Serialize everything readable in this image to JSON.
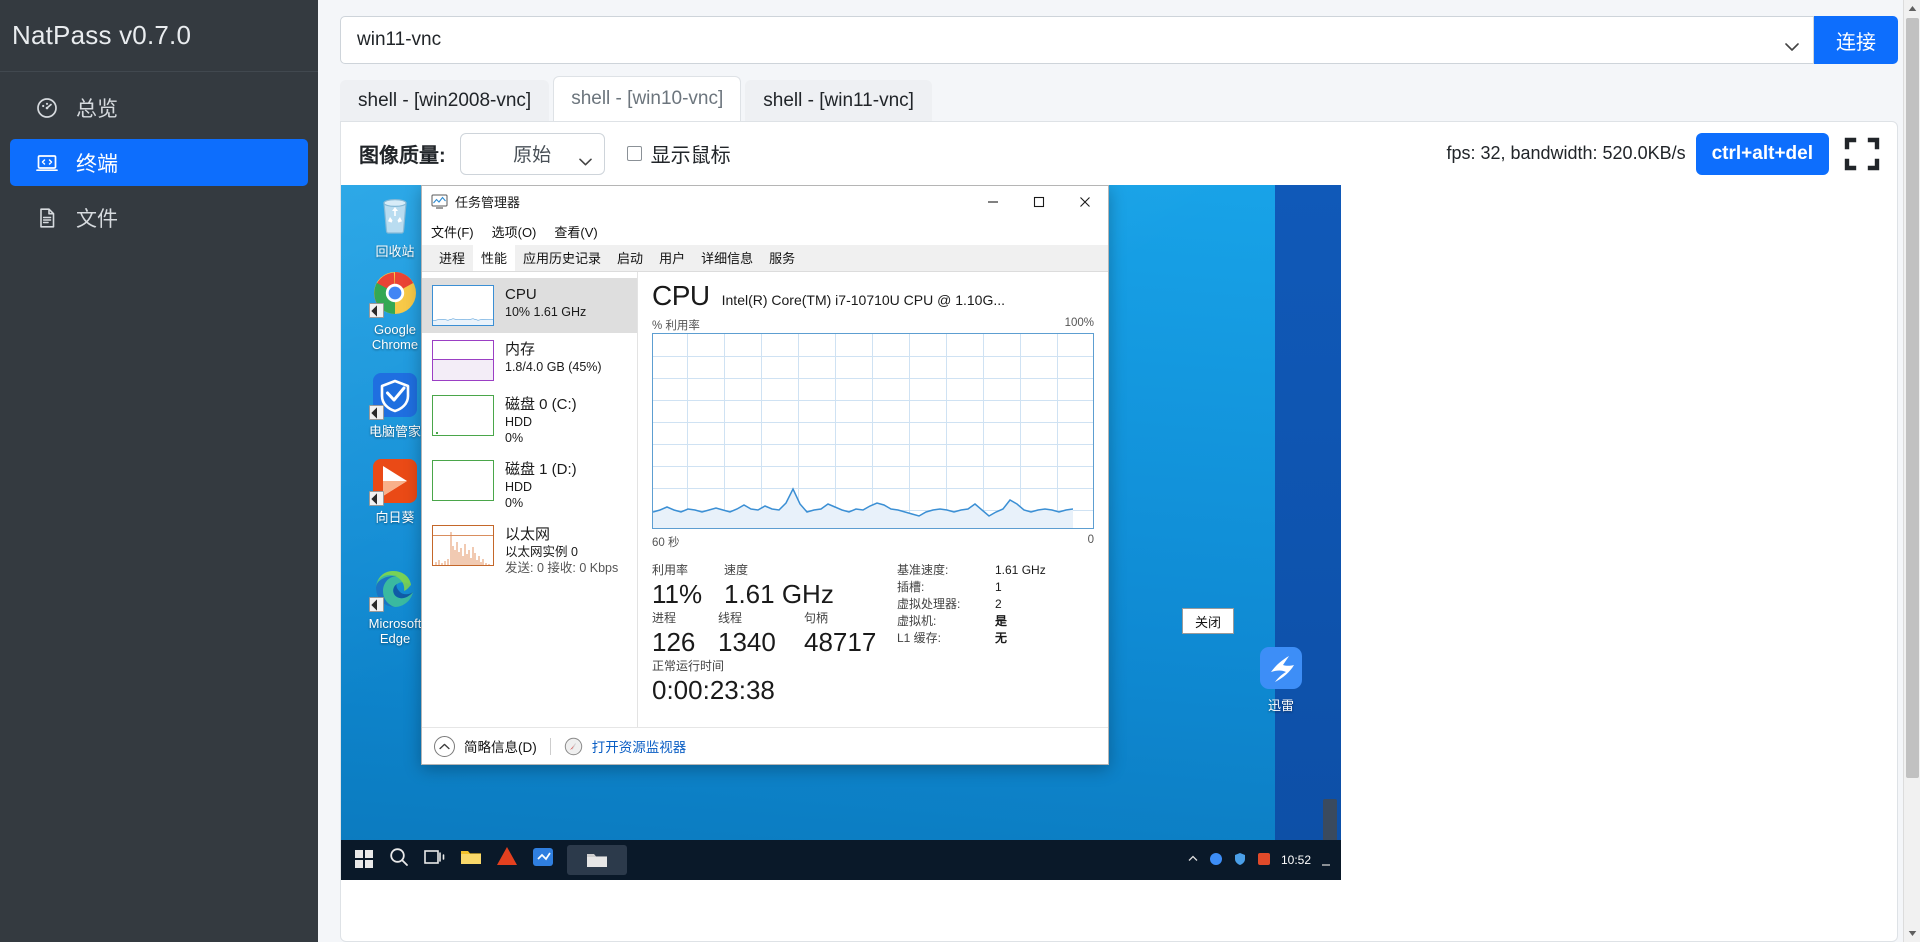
{
  "sidebar": {
    "brand": "NatPass v0.7.0",
    "items": [
      {
        "label": "总览",
        "icon": "dashboard-icon",
        "active": false
      },
      {
        "label": "终端",
        "icon": "terminal-icon",
        "active": true
      },
      {
        "label": "文件",
        "icon": "file-icon",
        "active": false
      }
    ]
  },
  "connect": {
    "selected": "win11-vnc",
    "button_label": "连接"
  },
  "tabs": [
    {
      "label": "shell - [win2008-vnc]",
      "active": false
    },
    {
      "label": "shell - [win10-vnc]",
      "active": true
    },
    {
      "label": "shell - [win11-vnc]",
      "active": false
    }
  ],
  "toolbar": {
    "quality_label": "图像质量:",
    "quality_value": "原始",
    "show_cursor_label": "显示鼠标",
    "show_cursor_checked": false,
    "stats": "fps: 32, bandwidth: 520.0KB/s",
    "cad_label": "ctrl+alt+del",
    "fullscreen_icon": "fullscreen-icon"
  },
  "desktop": {
    "icons": [
      {
        "label": "回收站",
        "icon": "recycle-bin-icon",
        "shortcut": false
      },
      {
        "label": "Google\nChrome",
        "icon": "chrome-icon",
        "shortcut": true
      },
      {
        "label": "电脑管家",
        "icon": "pc-manager-icon",
        "shortcut": true
      },
      {
        "label": "向日葵",
        "icon": "sunlogin-icon",
        "shortcut": true
      },
      {
        "label": "Microsoft\nEdge",
        "icon": "edge-icon",
        "shortcut": true
      }
    ],
    "xunlei_label": "迅雷",
    "close_button_label": "关闭",
    "clock": "10:52"
  },
  "task_manager": {
    "title": "任务管理器",
    "window_controls": {
      "minimize": "minimize-icon",
      "maximize": "maximize-icon",
      "close": "close-icon"
    },
    "menus": [
      "文件(F)",
      "选项(O)",
      "查看(V)"
    ],
    "tabs": [
      {
        "label": "进程",
        "active": false
      },
      {
        "label": "性能",
        "active": true
      },
      {
        "label": "应用历史记录",
        "active": false
      },
      {
        "label": "启动",
        "active": false
      },
      {
        "label": "用户",
        "active": false
      },
      {
        "label": "详细信息",
        "active": false
      },
      {
        "label": "服务",
        "active": false
      }
    ],
    "resources": [
      {
        "name": "CPU",
        "sub1": "10% 1.61 GHz",
        "sub2": "",
        "color": "#3b8fd4",
        "selected": true
      },
      {
        "name": "内存",
        "sub1": "1.8/4.0 GB (45%)",
        "sub2": "",
        "color": "#9b3fc4",
        "selected": false
      },
      {
        "name": "磁盘 0 (C:)",
        "sub1": "HDD",
        "sub2": "0%",
        "color": "#4aa64a",
        "selected": false
      },
      {
        "name": "磁盘 1 (D:)",
        "sub1": "HDD",
        "sub2": "0%",
        "color": "#4aa64a",
        "selected": false
      },
      {
        "name": "以太网",
        "sub1": "以太网实例 0",
        "sub2": "发送: 0 接收: 0 Kbps",
        "color": "#c4672a",
        "selected": false
      }
    ],
    "detail": {
      "heading": "CPU",
      "model": "Intel(R) Core(TM) i7-10710U CPU @ 1.10G...",
      "axis_y_label": "% 利用率",
      "axis_y_max": "100%",
      "axis_x_left": "60 秒",
      "axis_x_right": "0",
      "stats_left": [
        {
          "key": "利用率",
          "value": "11%"
        },
        {
          "key": "速度",
          "value": "1.61 GHz"
        }
      ],
      "stats_left2": [
        {
          "key": "进程",
          "value": "126"
        },
        {
          "key": "线程",
          "value": "1340"
        },
        {
          "key": "句柄",
          "value": "48717"
        }
      ],
      "uptime_label": "正常运行时间",
      "uptime_value": "0:00:23:38",
      "props": [
        {
          "key": "基准速度:",
          "value": "1.61 GHz",
          "bold": false
        },
        {
          "key": "插槽:",
          "value": "1",
          "bold": false
        },
        {
          "key": "虚拟处理器:",
          "value": "2",
          "bold": false
        },
        {
          "key": "虚拟机:",
          "value": "是",
          "bold": true
        },
        {
          "key": "L1 缓存:",
          "value": "无",
          "bold": true
        }
      ]
    },
    "footer": {
      "collapse_label": "简略信息(D)",
      "resource_monitor_label": "打开资源监视器"
    }
  },
  "chart_data": {
    "type": "area",
    "title": "CPU % 利用率",
    "ylabel": "% 利用率",
    "xlabel": "60 秒",
    "ylim": [
      0,
      100
    ],
    "xlim": [
      60,
      0
    ],
    "grid": true,
    "series": [
      {
        "name": "CPU 利用率",
        "color": "#3b8fd4",
        "values": [
          8,
          9,
          11,
          9,
          8,
          10,
          9,
          8,
          9,
          10,
          9,
          8,
          10,
          12,
          10,
          9,
          11,
          10,
          9,
          13,
          20,
          12,
          8,
          9,
          10,
          12,
          11,
          9,
          8,
          10,
          9,
          11,
          13,
          12,
          10,
          9,
          8,
          7,
          6,
          8,
          9,
          10,
          9,
          8,
          9,
          10,
          12,
          9,
          6,
          8,
          10,
          14,
          12,
          9,
          8,
          9,
          10,
          9,
          8,
          9,
          10
        ]
      }
    ]
  }
}
